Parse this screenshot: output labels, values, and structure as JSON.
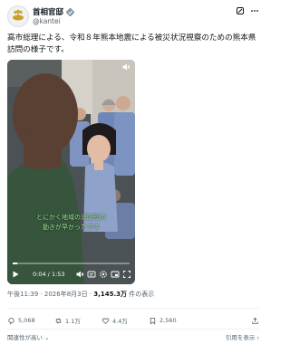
{
  "account": {
    "display_name": "首相官邸",
    "handle": "@kantei",
    "verified_color": "#829aab"
  },
  "tweet": {
    "text": "高市総理による、令和８年熊本地震による被災状況視察のための熊本県訪問の様子です。"
  },
  "video": {
    "subtitle_line1": "とにかく地域の消防団の",
    "subtitle_line2": "動きが早かったです",
    "current_time": "0:04",
    "duration": "1:53",
    "progress_fraction": 0.035,
    "subtitle_color": "#9de58f"
  },
  "meta": {
    "time": "午後11:39",
    "date": "2026年8月3日",
    "views_count": "3,145.3万",
    "views_suffix": "件の表示"
  },
  "stats": {
    "replies": "5,068",
    "reposts": "1.1万",
    "likes": "4.4万",
    "bookmarks": "2,560"
  },
  "footer": {
    "relevant_label": "関連性が高い",
    "quotes_label": "引用を表示"
  },
  "icons": {
    "reply": "reply-icon",
    "repost": "repost-icon",
    "like": "heart-icon",
    "bookmark": "bookmark-icon",
    "share": "share-icon",
    "grok": "grok-icon",
    "more": "more-icon"
  }
}
